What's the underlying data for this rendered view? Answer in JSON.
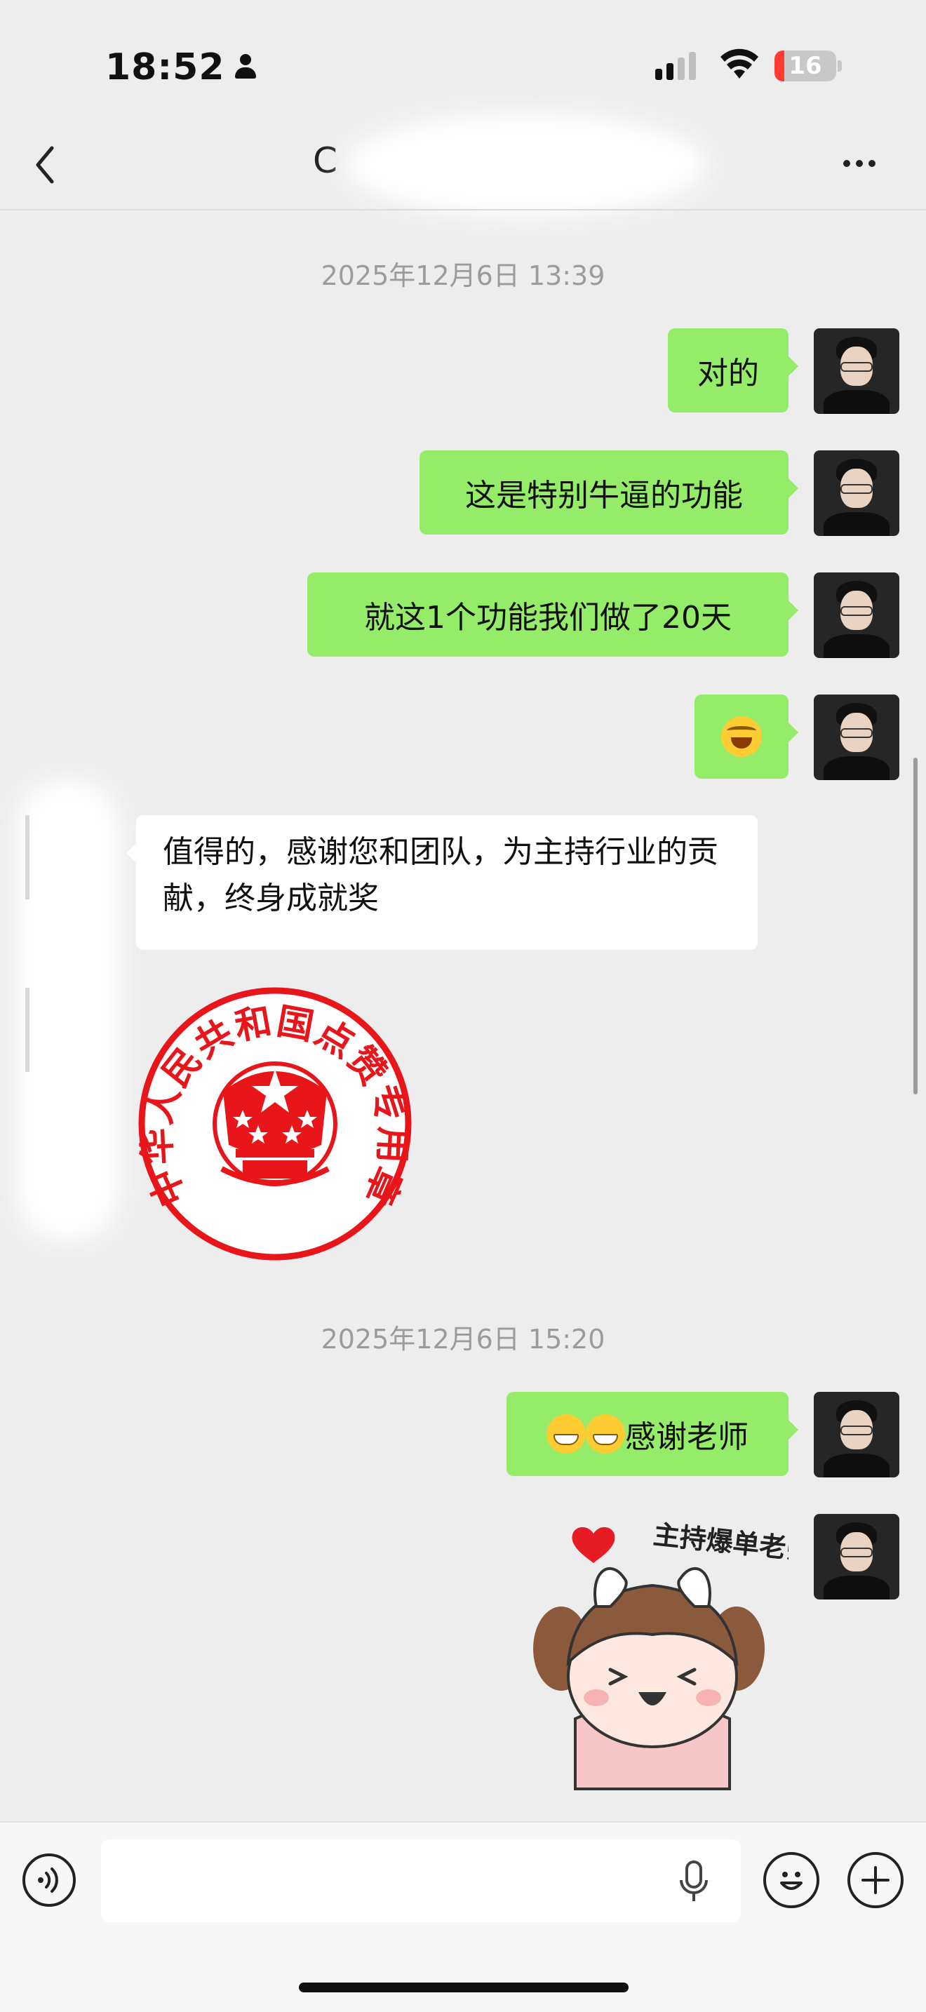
{
  "status_bar": {
    "time": "18:52",
    "battery": "16",
    "battery_level": 0.16,
    "signal_bars": 2
  },
  "nav": {
    "back_icon": "chevron-left-icon",
    "title_visible": "C",
    "more_icon": "ellipsis-icon"
  },
  "messages": {
    "timestamp_1": "2025年12月6日 13:39",
    "msg_1": "对的",
    "msg_2": "这是特别牛逼的功能",
    "msg_3": "就这1个功能我们做了20天",
    "msg_4_emoji": "laughing-crying-emoji",
    "incoming_1": "值得的，感谢您和团队，为主持行业的贡献，终身成就奖",
    "seal_text": "中华人民共和国点赞专用章",
    "timestamp_2": "2025年12月6日 15:20",
    "msg_5_text": "感谢老师",
    "msg_5_emoji": "grinning-emoji",
    "sticker_text": "主持爆单老师"
  },
  "bottom_bar": {
    "voice_icon": "voice-icon",
    "mic_icon": "microphone-icon",
    "emoji_icon": "smiley-icon",
    "plus_icon": "plus-icon"
  },
  "colors": {
    "outgoing_bubble": "#95ec69",
    "incoming_bubble": "#ffffff",
    "background": "#ededed",
    "seal_red": "#e8151b"
  }
}
